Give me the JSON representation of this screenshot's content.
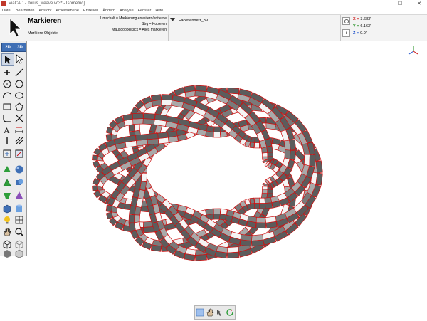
{
  "window": {
    "title": "ViaCAD - [torus_weave.vc3* - Isometric]",
    "minimize": "–",
    "maximize": "☐",
    "close": "✕"
  },
  "menu": [
    "Datei",
    "Bearbeiten",
    "Ansicht",
    "Arbeitsebene",
    "Erstellen",
    "Ändern",
    "Analyse",
    "Fenster",
    "Hilfe"
  ],
  "tool": {
    "name": "Markieren",
    "subtitle": "Markiere Objekte",
    "hints": [
      "Umschalt = Markierung erweitern/entferne",
      "Strg = Kopieren",
      "Mausdoppelklick = Alles markieren"
    ]
  },
  "layer": {
    "name": "Facettennetz_39"
  },
  "coords": {
    "x_label": "X =",
    "x_value": "3.683\"",
    "y_label": "Y =",
    "y_value": "6.163\"",
    "z_label": "Z =",
    "z_value": "0.0\""
  },
  "palette": {
    "mode_2d": "2D",
    "mode_3d": "3D"
  },
  "colors": {
    "wire": "#cc1111",
    "panel": "#ececec",
    "accent": "#3f6fb5"
  }
}
